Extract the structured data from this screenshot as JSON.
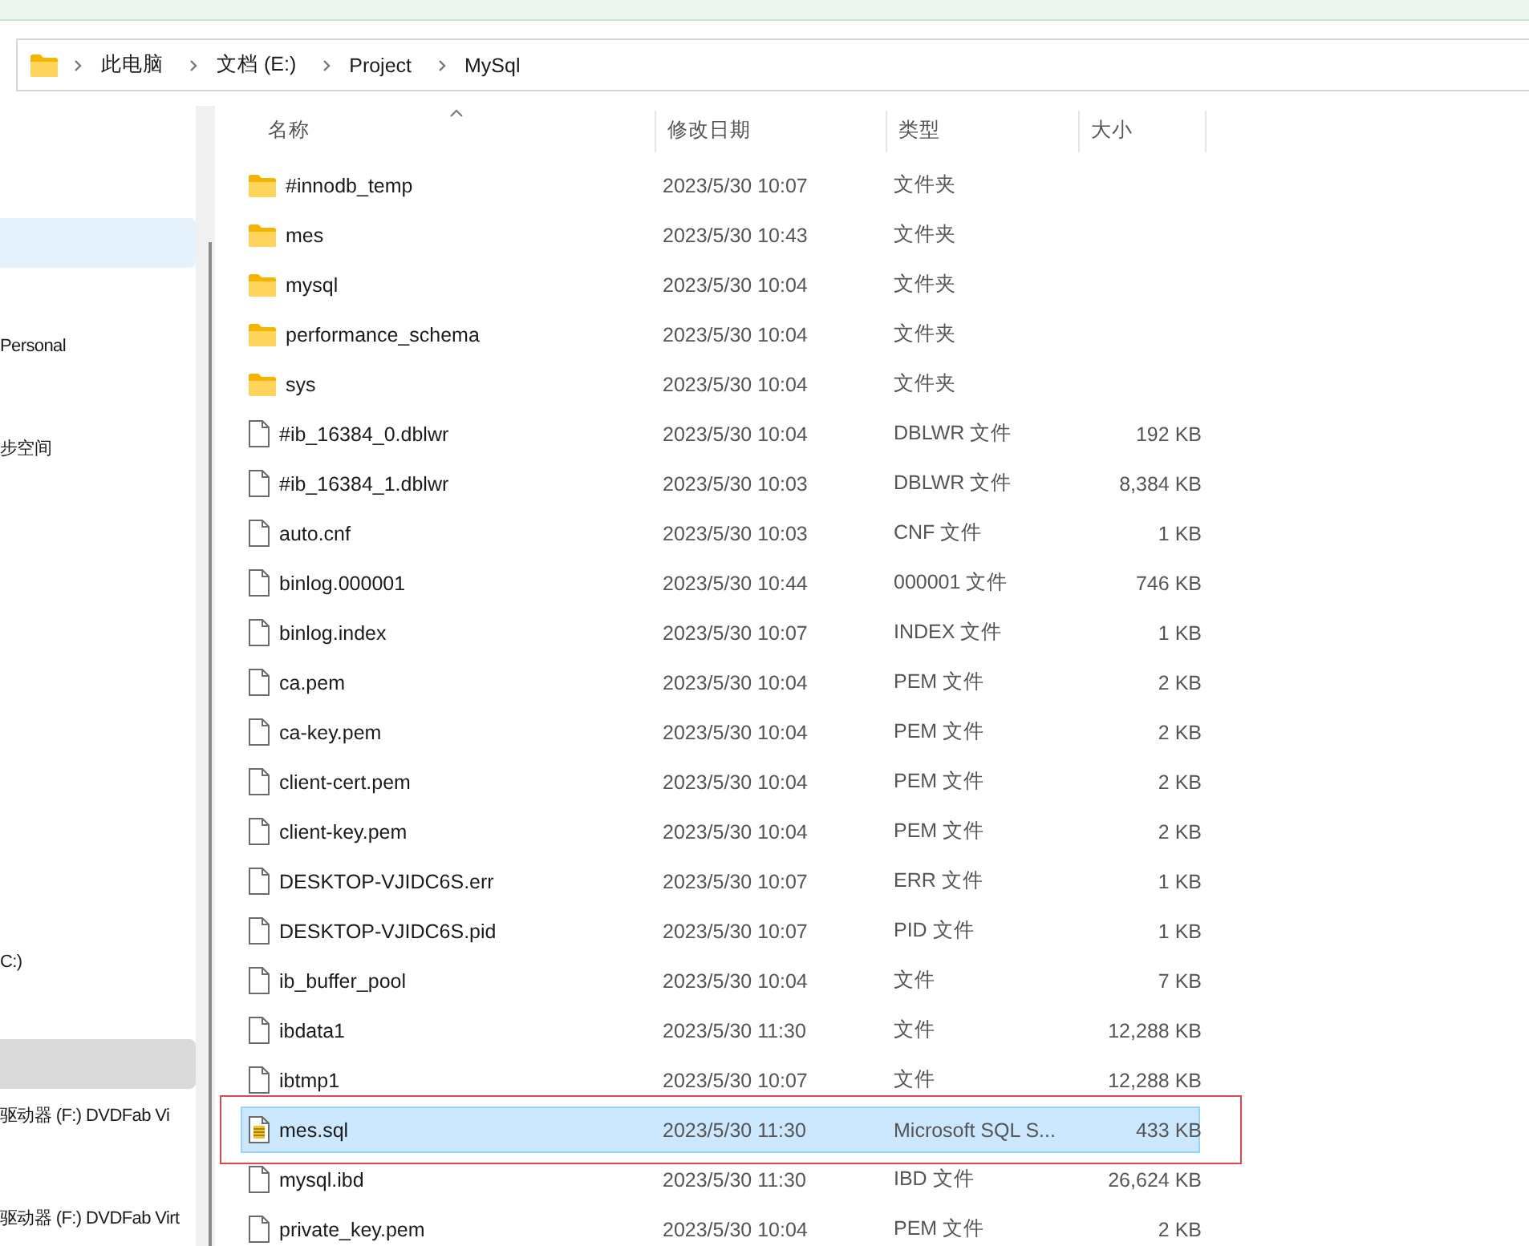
{
  "address_bar": {
    "path": [
      "此电脑",
      "文档 (E:)",
      "Project",
      "MySql"
    ]
  },
  "sidebar": {
    "items": [
      {
        "selected": true,
        "hovered": false
      },
      {
        "label": "Personal",
        "selected": false,
        "hovered": false
      },
      {
        "label": "步空间",
        "selected": false,
        "hovered": false
      },
      {
        "label": "C:)",
        "selected": false,
        "hovered": false
      },
      {
        "selected": false,
        "hovered": true
      },
      {
        "label": "驱动器 (F:) DVDFab Vi",
        "selected": false,
        "hovered": false
      },
      {
        "label": "驱动器 (F:) DVDFab Virt",
        "selected": false,
        "hovered": false
      }
    ]
  },
  "table": {
    "columns": [
      "名称",
      "修改日期",
      "类型",
      "大小"
    ],
    "rows": [
      {
        "kind": "folder",
        "name": "#innodb_temp",
        "date": "2023/5/30 10:07",
        "type": "文件夹",
        "selected": false
      },
      {
        "kind": "folder",
        "name": "mes",
        "date": "2023/5/30 10:43",
        "type": "文件夹",
        "selected": false
      },
      {
        "kind": "folder",
        "name": "mysql",
        "date": "2023/5/30 10:04",
        "type": "文件夹",
        "selected": false
      },
      {
        "kind": "folder",
        "name": "performance_schema",
        "date": "2023/5/30 10:04",
        "type": "文件夹",
        "selected": false
      },
      {
        "kind": "folder",
        "name": "sys",
        "date": "2023/5/30 10:04",
        "type": "文件夹",
        "selected": false
      },
      {
        "kind": "file",
        "name": "#ib_16384_0.dblwr",
        "date": "2023/5/30 10:04",
        "type": "DBLWR 文件",
        "size": "192 KB",
        "selected": false
      },
      {
        "kind": "file",
        "name": "#ib_16384_1.dblwr",
        "date": "2023/5/30 10:03",
        "type": "DBLWR 文件",
        "size": "8,384 KB",
        "selected": false
      },
      {
        "kind": "file",
        "name": "auto.cnf",
        "date": "2023/5/30 10:03",
        "type": "CNF 文件",
        "size": "1 KB",
        "selected": false
      },
      {
        "kind": "file",
        "name": "binlog.000001",
        "date": "2023/5/30 10:44",
        "type": "000001 文件",
        "size": "746 KB",
        "selected": false
      },
      {
        "kind": "file",
        "name": "binlog.index",
        "date": "2023/5/30 10:07",
        "type": "INDEX 文件",
        "size": "1 KB",
        "selected": false
      },
      {
        "kind": "file",
        "name": "ca.pem",
        "date": "2023/5/30 10:04",
        "type": "PEM 文件",
        "size": "2 KB",
        "selected": false
      },
      {
        "kind": "file",
        "name": "ca-key.pem",
        "date": "2023/5/30 10:04",
        "type": "PEM 文件",
        "size": "2 KB",
        "selected": false
      },
      {
        "kind": "file",
        "name": "client-cert.pem",
        "date": "2023/5/30 10:04",
        "type": "PEM 文件",
        "size": "2 KB",
        "selected": false
      },
      {
        "kind": "file",
        "name": "client-key.pem",
        "date": "2023/5/30 10:04",
        "type": "PEM 文件",
        "size": "2 KB",
        "selected": false
      },
      {
        "kind": "file",
        "name": "DESKTOP-VJIDC6S.err",
        "date": "2023/5/30 10:07",
        "type": "ERR 文件",
        "size": "1 KB",
        "selected": false
      },
      {
        "kind": "file",
        "name": "DESKTOP-VJIDC6S.pid",
        "date": "2023/5/30 10:07",
        "type": "PID 文件",
        "size": "1 KB",
        "selected": false
      },
      {
        "kind": "file",
        "name": "ib_buffer_pool",
        "date": "2023/5/30 10:04",
        "type": "文件",
        "size": "7 KB",
        "selected": false
      },
      {
        "kind": "file",
        "name": "ibdata1",
        "date": "2023/5/30 11:30",
        "type": "文件",
        "size": "12,288 KB",
        "selected": false
      },
      {
        "kind": "file",
        "name": "ibtmp1",
        "date": "2023/5/30 10:07",
        "type": "文件",
        "size": "12,288 KB",
        "selected": false
      },
      {
        "kind": "sql",
        "name": "mes.sql",
        "date": "2023/5/30 11:30",
        "type": "Microsoft SQL S...",
        "size": "433 KB",
        "selected": true,
        "annotated": true
      },
      {
        "kind": "file",
        "name": "mysql.ibd",
        "date": "2023/5/30 11:30",
        "type": "IBD 文件",
        "size": "26,624 KB",
        "selected": false
      },
      {
        "kind": "file",
        "name": "private_key.pem",
        "date": "2023/5/30 10:04",
        "type": "PEM 文件",
        "size": "2 KB",
        "selected": false
      }
    ]
  }
}
